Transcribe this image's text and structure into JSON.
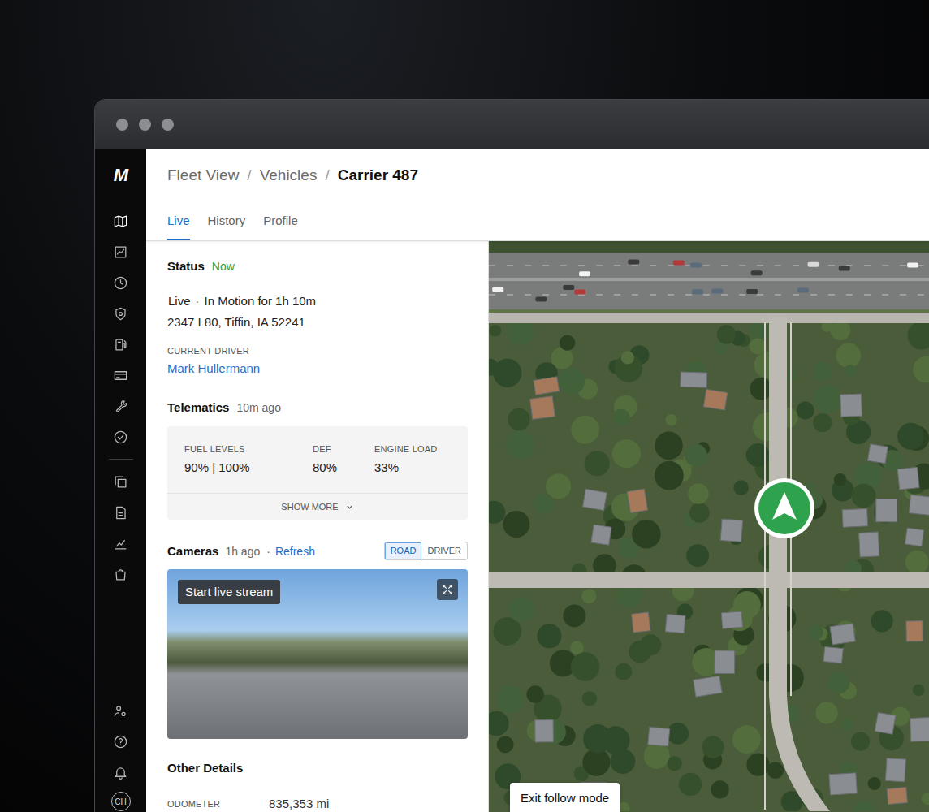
{
  "sidebar": {
    "logo": "M",
    "main_items": [
      {
        "selected": true
      },
      {
        "selected": false
      },
      {
        "selected": false
      },
      {
        "selected": false
      },
      {
        "selected": false
      },
      {
        "selected": false
      },
      {
        "selected": false
      },
      {
        "selected": false
      }
    ],
    "secondary_items": [
      {
        "selected": false
      },
      {
        "selected": false
      },
      {
        "selected": false
      },
      {
        "selected": false
      }
    ],
    "footer_items": [
      {
        "selected": false
      },
      {
        "selected": false
      },
      {
        "selected": false
      }
    ],
    "avatar": "CH"
  },
  "breadcrumb": {
    "separator": "/",
    "items": [
      {
        "label": "Fleet View",
        "current": false
      },
      {
        "label": "Vehicles",
        "current": false
      },
      {
        "label": "Carrier 487",
        "current": true
      }
    ]
  },
  "tabs": [
    {
      "label": "Live",
      "selected": true
    },
    {
      "label": "History",
      "selected": false
    },
    {
      "label": "Profile",
      "selected": false
    }
  ],
  "status": {
    "title": "Status",
    "time": "Now",
    "state": "Live",
    "separator": "·",
    "motion": "In Motion for 1h 10m",
    "address": "2347 I 80, Tiffin, IA 52241",
    "driver_label": "CURRENT DRIVER",
    "driver": "Mark Hullermann"
  },
  "telematics": {
    "title": "Telematics",
    "time": "10m ago",
    "metrics": [
      {
        "label": "FUEL LEVELS",
        "value": "90% | 100%"
      },
      {
        "label": "DEF",
        "value": "80%"
      },
      {
        "label": "ENGINE LOAD",
        "value": "33%"
      }
    ],
    "show_more": "SHOW MORE"
  },
  "cameras": {
    "title": "Cameras",
    "time": "1h ago",
    "separator": "·",
    "refresh": "Refresh",
    "views": [
      {
        "label": "ROAD",
        "selected": true
      },
      {
        "label": "DRIVER",
        "selected": false
      }
    ],
    "live_button": "Start live stream"
  },
  "other_details": {
    "title": "Other Details",
    "fields": [
      {
        "label": "ODOMETER",
        "value": "835,353 mi"
      }
    ]
  },
  "map": {
    "follow_button": "Exit follow mode"
  }
}
